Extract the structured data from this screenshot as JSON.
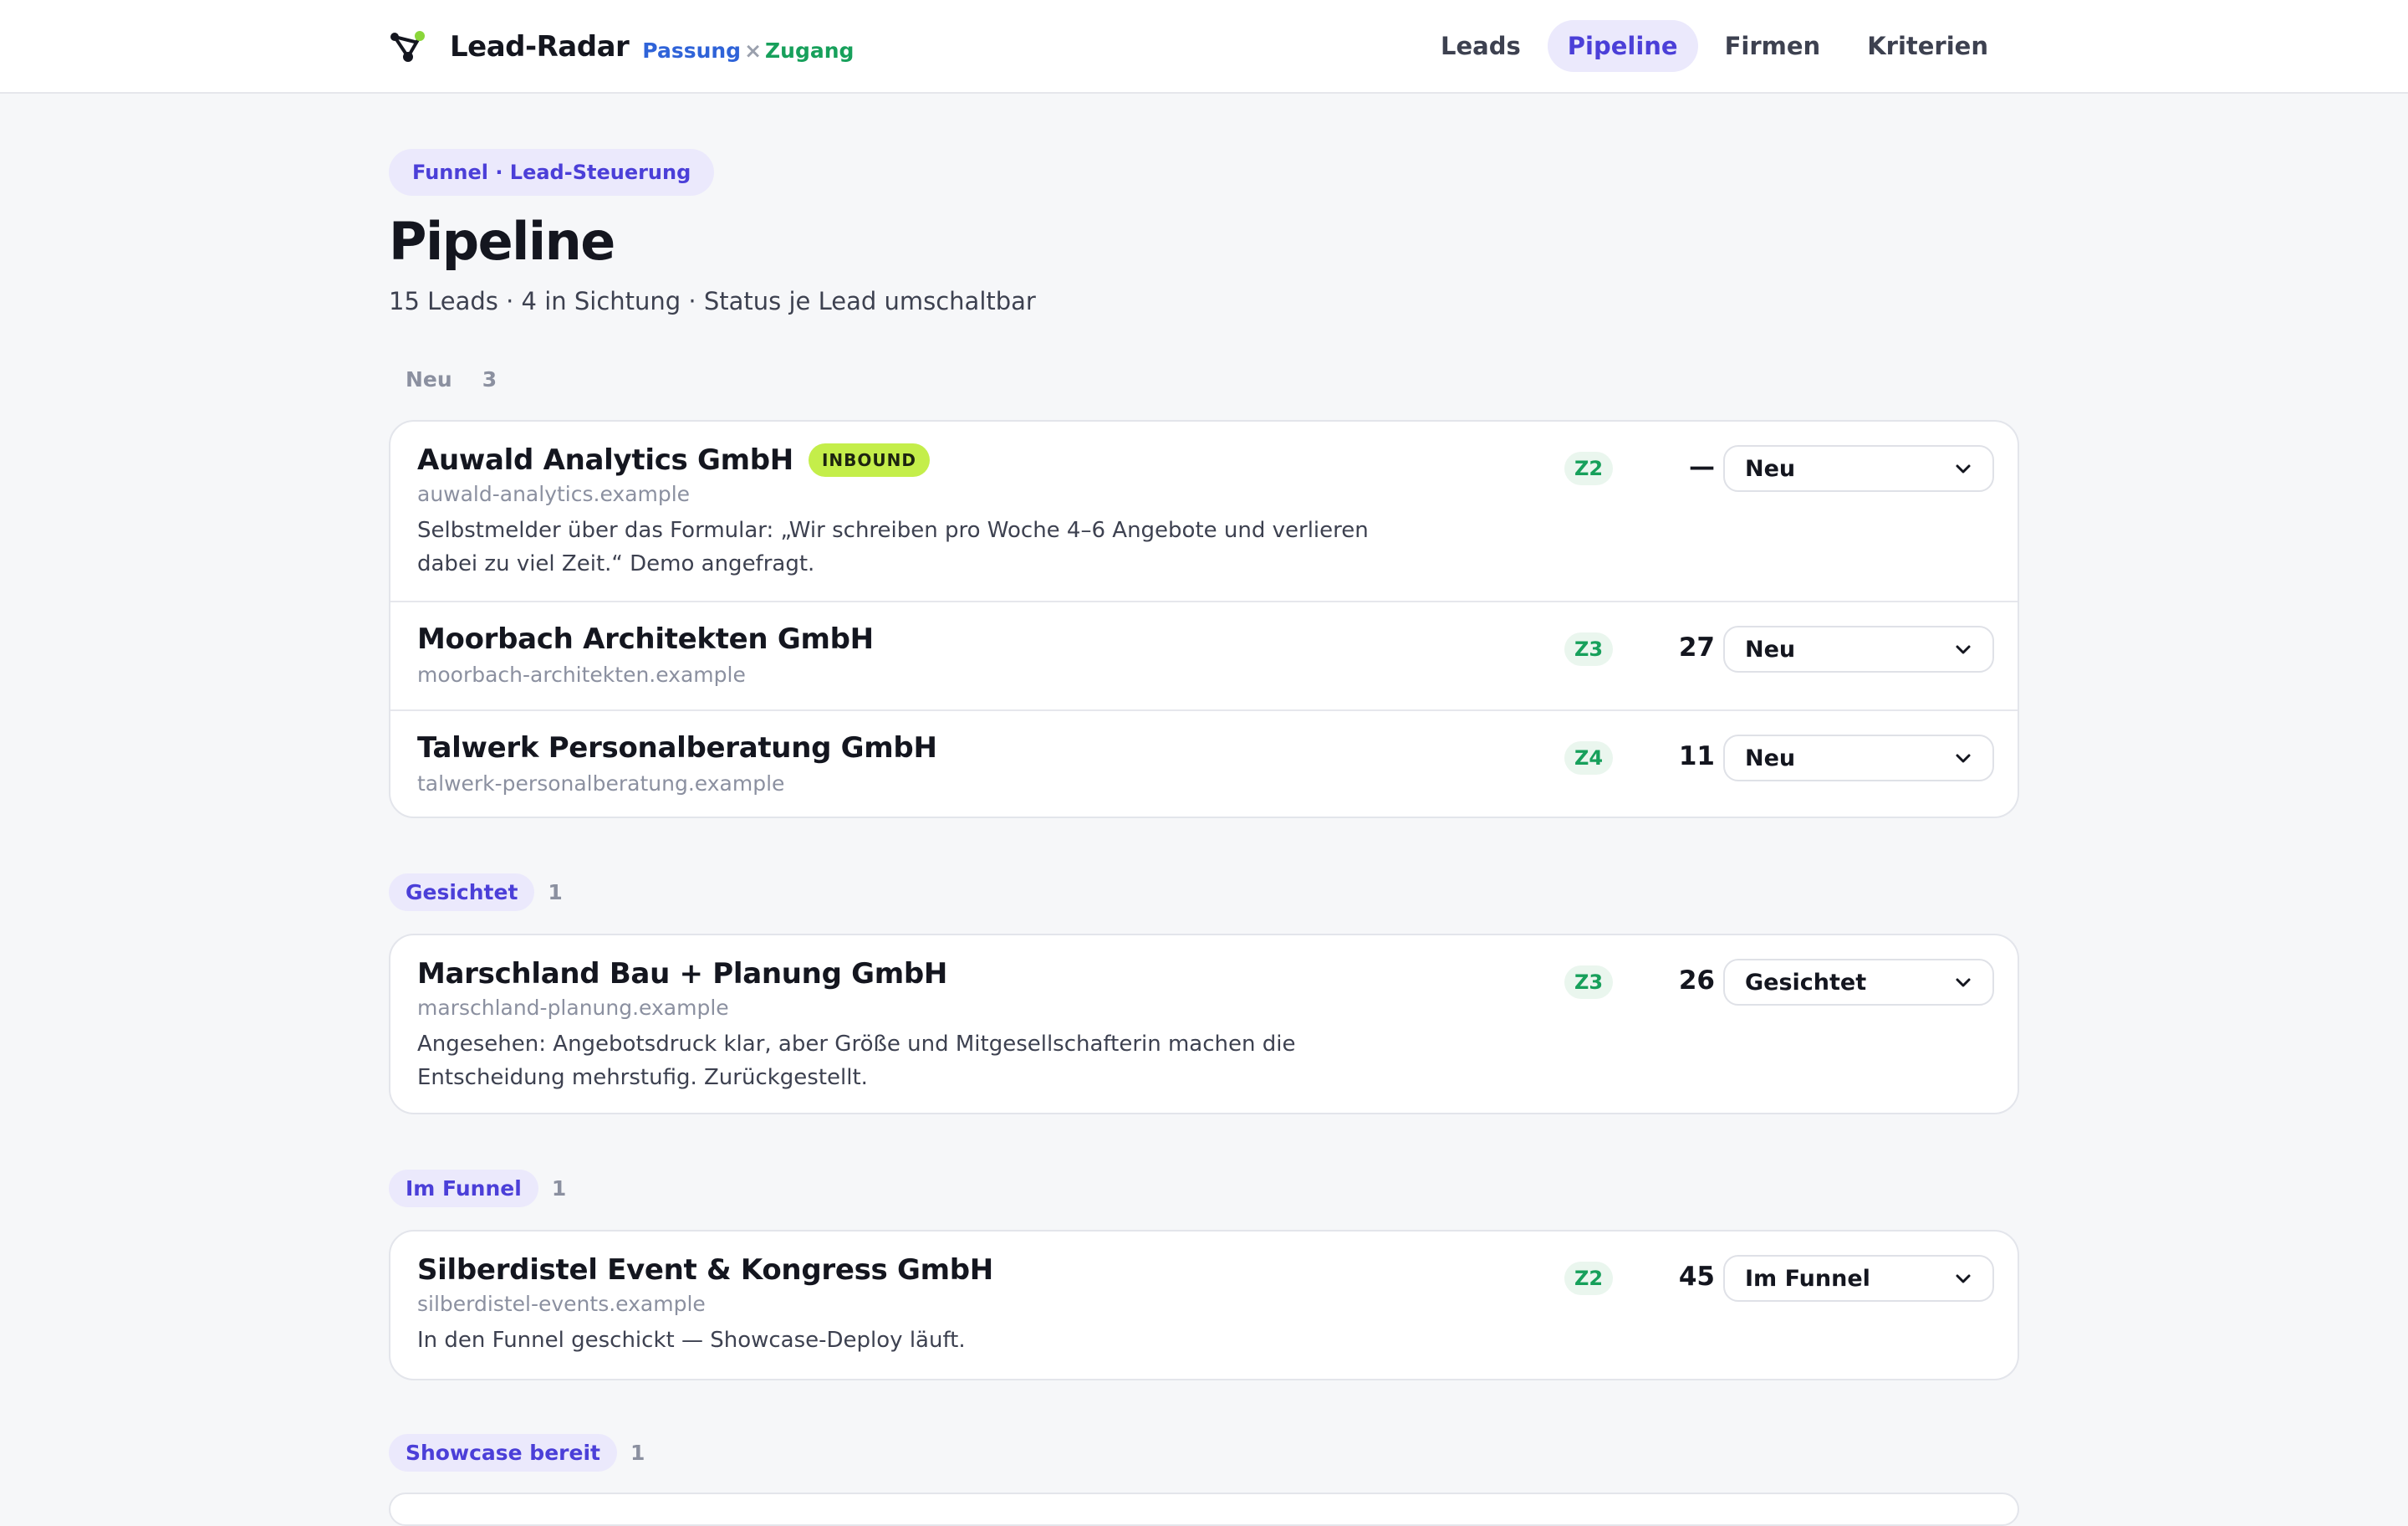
{
  "header": {
    "brand": "Lead-Radar",
    "tag_left": "Passung",
    "tag_sep": "×",
    "tag_right": "Zugang",
    "nav": [
      "Leads",
      "Pipeline",
      "Firmen",
      "Kriterien"
    ],
    "active_nav": "Pipeline"
  },
  "page": {
    "eyebrow": "Funnel · Lead-Steuerung",
    "title": "Pipeline",
    "subtitle": "15 Leads · 4 in Sichtung · Status je Lead umschaltbar"
  },
  "groups": [
    {
      "label": "Neu",
      "count": "3",
      "leads": [
        {
          "company": "Auwald Analytics GmbH",
          "badge": "INBOUND",
          "domain": "auwald-analytics.example",
          "note": "Selbstmelder über das Formular: „Wir schreiben pro Woche 4–6 Angebote und verlieren dabei zu viel Zeit.“ Demo angefragt.",
          "zone": "Z2",
          "score": "—",
          "status": "Neu"
        },
        {
          "company": "Moorbach Architekten GmbH",
          "domain": "moorbach-architekten.example",
          "zone": "Z3",
          "score": "27",
          "status": "Neu"
        },
        {
          "company": "Talwerk Personalberatung GmbH",
          "domain": "talwerk-personalberatung.example",
          "zone": "Z4",
          "score": "11",
          "status": "Neu"
        }
      ]
    },
    {
      "label": "Gesichtet",
      "count": "1",
      "leads": [
        {
          "company": "Marschland Bau + Planung GmbH",
          "domain": "marschland-planung.example",
          "note": "Angesehen: Angebotsdruck klar, aber Größe und Mitgesellschafterin machen die Entscheidung mehrstufig. Zurückgestellt.",
          "zone": "Z3",
          "score": "26",
          "status": "Gesichtet"
        }
      ]
    },
    {
      "label": "Im Funnel",
      "count": "1",
      "leads": [
        {
          "company": "Silberdistel Event & Kongress GmbH",
          "domain": "silberdistel-events.example",
          "note": "In den Funnel geschickt — Showcase-Deploy läuft.",
          "zone": "Z2",
          "score": "45",
          "status": "Im Funnel"
        }
      ]
    },
    {
      "label": "Showcase bereit",
      "count": "1",
      "leads": []
    }
  ],
  "colors": {
    "accent": "#4b3fd8",
    "accent_bg": "#ebe9fc",
    "zone_green": "#17a05b",
    "inbound_badge": "#c4ee4a"
  },
  "icons": {
    "brand": "radar-nodes-icon",
    "select": "chevron-down-icon"
  }
}
